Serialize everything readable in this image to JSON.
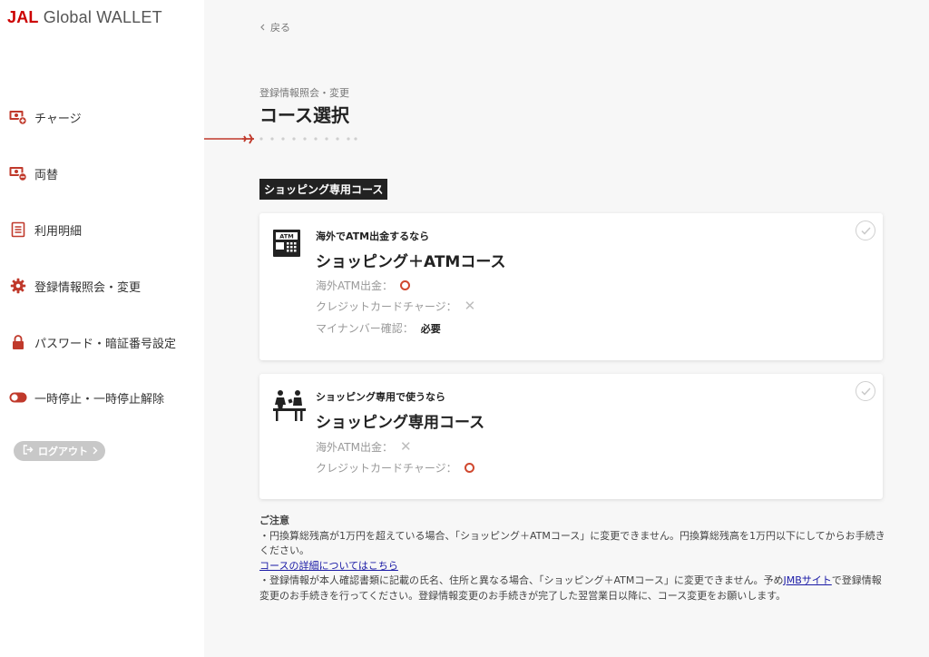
{
  "app": {
    "logo_brand": "JAL",
    "logo_rest": " Global WALLET"
  },
  "sidebar": {
    "items": [
      {
        "label": "チャージ",
        "icon": "money-plus-icon"
      },
      {
        "label": "両替",
        "icon": "money-exchange-icon"
      },
      {
        "label": "利用明細",
        "icon": "list-icon"
      },
      {
        "label": "登録情報照会・変更",
        "icon": "gear-icon"
      },
      {
        "label": "パスワード・暗証番号設定",
        "icon": "lock-icon"
      },
      {
        "label": "一時停止・一時停止解除",
        "icon": "toggle-icon"
      }
    ],
    "logout_label": "ログアウト"
  },
  "header": {
    "back_label": "戻る",
    "breadcrumb": "登録情報照会・変更",
    "title": "コース選択"
  },
  "section_tag": "ショッピング専用コース",
  "cards": [
    {
      "sub": "海外でATM出金するなら",
      "name": "ショッピング＋ATMコース",
      "icon": "atm-icon",
      "features": [
        {
          "label": "海外ATM出金：",
          "mark": "circle"
        },
        {
          "label": "クレジットカードチャージ：",
          "mark": "x"
        },
        {
          "label": "マイナンバー確認：",
          "mark": "text",
          "text": "必要"
        }
      ]
    },
    {
      "sub": "ショッピング専用で使うなら",
      "name": "ショッピング専用コース",
      "icon": "shopping-counter-icon",
      "features": [
        {
          "label": "海外ATM出金：",
          "mark": "x"
        },
        {
          "label": "クレジットカードチャージ：",
          "mark": "circle"
        }
      ]
    }
  ],
  "notes": {
    "title": "ご注意",
    "line1": "・円換算総残高が1万円を超えている場合、「ショッピング＋ATMコース」に変更できません。円換算総残高を1万円以下にしてからお手続きください。",
    "link1": "コースの詳細についてはこちら",
    "line2_pre": "・登録情報が本人確認書類に記載の氏名、住所と異なる場合、「ショッピング＋ATMコース」に変更できません。予め",
    "link2": "JMBサイト",
    "line2_post": "で登録情報変更のお手続きを行ってください。登録情報変更のお手続きが完了した翌営業日以降に、コース変更をお願いします。"
  },
  "colors": {
    "brand_red": "#cc0000",
    "circle_mark": "#d0482f",
    "link": "#1a1aa6"
  }
}
